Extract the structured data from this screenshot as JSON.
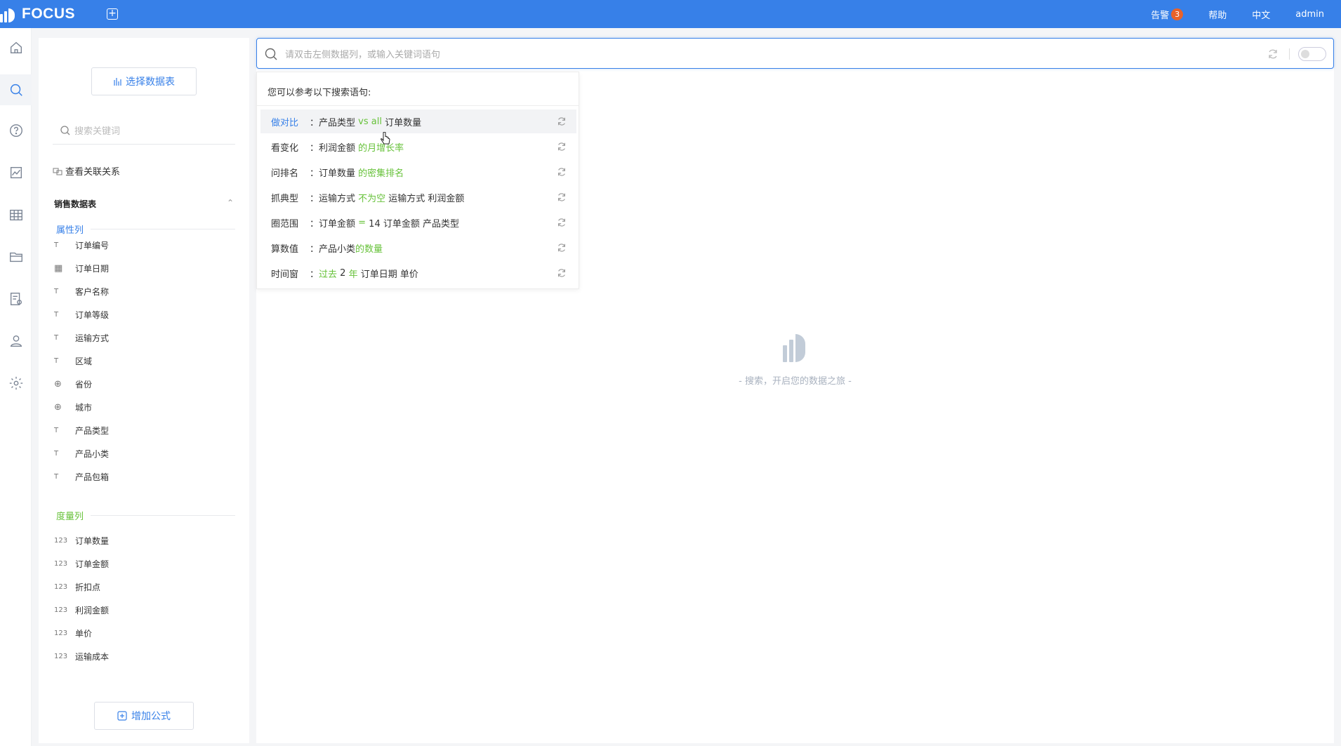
{
  "app": {
    "logo_text": "FOCUS"
  },
  "header": {
    "alerts_label": "告警",
    "alerts_count": "3",
    "help_label": "帮助",
    "language_label": "中文",
    "user_label": "admin"
  },
  "rail": {
    "items": [
      "home-icon",
      "search-icon",
      "help-icon",
      "chart-icon",
      "table-icon",
      "folder-icon",
      "data-settings-icon",
      "user-icon",
      "settings-icon"
    ],
    "active": "search-icon"
  },
  "data_panel": {
    "select_table_label": "选择数据表",
    "search_placeholder": "搜索关键词",
    "relations_label": "查看关联关系",
    "table_name": "销售数据表",
    "attribute_group_label": "属性列",
    "attribute_columns": [
      {
        "type": "text",
        "name": "订单编号"
      },
      {
        "type": "date",
        "name": "订单日期"
      },
      {
        "type": "text",
        "name": "客户名称"
      },
      {
        "type": "text",
        "name": "订单等级"
      },
      {
        "type": "text",
        "name": "运输方式"
      },
      {
        "type": "text",
        "name": "区域"
      },
      {
        "type": "geo",
        "name": "省份"
      },
      {
        "type": "geo",
        "name": "城市"
      },
      {
        "type": "text",
        "name": "产品类型"
      },
      {
        "type": "text",
        "name": "产品小类"
      },
      {
        "type": "text",
        "name": "产品包箱"
      }
    ],
    "measure_group_label": "度量列",
    "measure_type_label": "123",
    "measure_columns": [
      "订单数量",
      "订单金额",
      "折扣点",
      "利润金额",
      "单价",
      "运输成本"
    ],
    "add_formula_label": "增加公式"
  },
  "query": {
    "placeholder": "请双击左侧数据列，或输入关键词语句"
  },
  "suggestions": {
    "title": "您可以参考以下搜索语句:",
    "rows": [
      {
        "kind": "做对比",
        "segments": [
          {
            "t": "：产品类型 ",
            "g": false
          },
          {
            "t": "vs all",
            "g": true
          },
          {
            "t": " 订单数量",
            "g": false
          }
        ]
      },
      {
        "kind": "看变化",
        "segments": [
          {
            "t": "：利润金额 ",
            "g": false
          },
          {
            "t": "的月增长率",
            "g": true
          }
        ]
      },
      {
        "kind": "问排名",
        "segments": [
          {
            "t": "：订单数量 ",
            "g": false
          },
          {
            "t": "的密集排名",
            "g": true
          }
        ]
      },
      {
        "kind": "抓典型",
        "segments": [
          {
            "t": "：运输方式 ",
            "g": false
          },
          {
            "t": "不为空",
            "g": true
          },
          {
            "t": " 运输方式 利润金额",
            "g": false
          }
        ]
      },
      {
        "kind": "圈范围",
        "segments": [
          {
            "t": "：订单金额 ",
            "g": false
          },
          {
            "t": "=",
            "g": true
          },
          {
            "t": " 14 订单金额 产品类型",
            "g": false
          }
        ]
      },
      {
        "kind": "算数值",
        "segments": [
          {
            "t": "：产品小类",
            "g": false
          },
          {
            "t": "的数量",
            "g": true
          }
        ]
      },
      {
        "kind": "时间窗",
        "segments": [
          {
            "t": "：",
            "g": false
          },
          {
            "t": "过去",
            "g": true
          },
          {
            "t": " 2 ",
            "g": false
          },
          {
            "t": "年",
            "g": true
          },
          {
            "t": " 订单日期 单价",
            "g": false
          }
        ]
      }
    ]
  },
  "empty_state": {
    "text": "- 搜索，开启您的数据之旅 -"
  },
  "colors": {
    "brand": "#3780e8",
    "keyword_green": "#67c23a",
    "badge": "#e8622a"
  }
}
